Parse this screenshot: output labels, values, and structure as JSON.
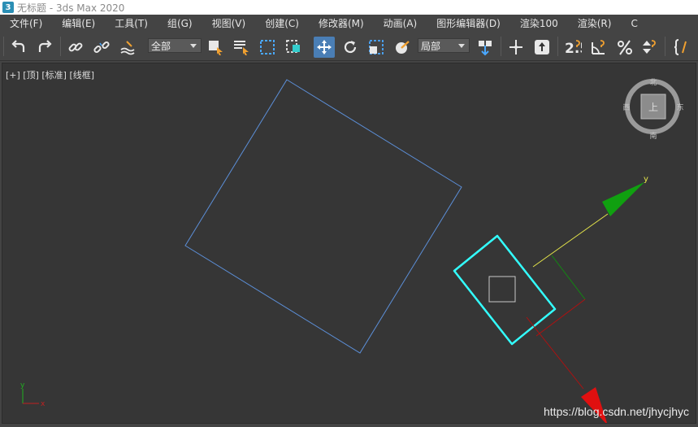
{
  "window": {
    "title": "无标题 - 3ds Max 2020",
    "app_icon": "3"
  },
  "menu": [
    "文件(F)",
    "编辑(E)",
    "工具(T)",
    "组(G)",
    "视图(V)",
    "创建(C)",
    "修改器(M)",
    "动画(A)",
    "图形编辑器(D)",
    "渲染100",
    "渲染(R)",
    "C"
  ],
  "toolbar": {
    "selection_filter": "全部",
    "reference_coord": "局部",
    "snap_label": "2.5"
  },
  "viewport": {
    "label": "[+] [顶] [标准] [线框]",
    "viewcube": {
      "top": "上",
      "north": "北",
      "south": "南",
      "east": "东",
      "west": "西"
    },
    "axis_y_label": "y",
    "mini_axis_y": "y",
    "mini_axis_x": "x"
  },
  "watermark": "https://blog.csdn.net/jhycjhyc",
  "colors": {
    "viewport_bg": "#363636",
    "wire_blue": "#5c8fd8",
    "selected_cyan": "#33ffff",
    "gizmo_green": "#10a010",
    "gizmo_red": "#e01010",
    "gizmo_yellow": "#e6e64a",
    "toolbar_active": "#4a7eb5"
  }
}
